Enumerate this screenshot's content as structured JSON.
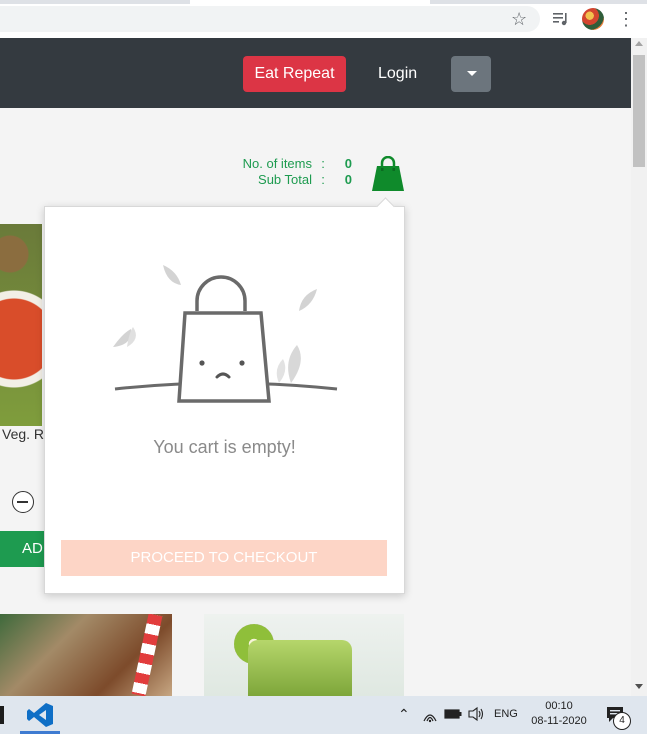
{
  "browser": {
    "icons": [
      "star-icon",
      "media-control-icon",
      "profile-avatar",
      "more-vert-icon"
    ]
  },
  "navbar": {
    "eat_repeat_label": "Eat Repeat",
    "login_label": "Login",
    "dropdown_icon": "caret-down-icon",
    "colors": {
      "bg": "#343a40",
      "eat_repeat": "#dc3545",
      "dropdown": "#6c757d"
    }
  },
  "cart_summary": {
    "items_label": "No. of items",
    "items_value": "0",
    "subtotal_label": "Sub Total",
    "subtotal_value": "0",
    "separator": ":",
    "color": "#1e9b50"
  },
  "products": {
    "card1_name": "Veg. R",
    "card1_add_label": "AD"
  },
  "cart_popup": {
    "empty_message": "You cart is empty!",
    "checkout_label": "PROCEED TO CHECKOUT",
    "checkout_color": "#fdd5c6"
  },
  "taskbar": {
    "lang": "ENG",
    "time": "00:10",
    "date": "08-11-2020",
    "notification_count": "4"
  }
}
